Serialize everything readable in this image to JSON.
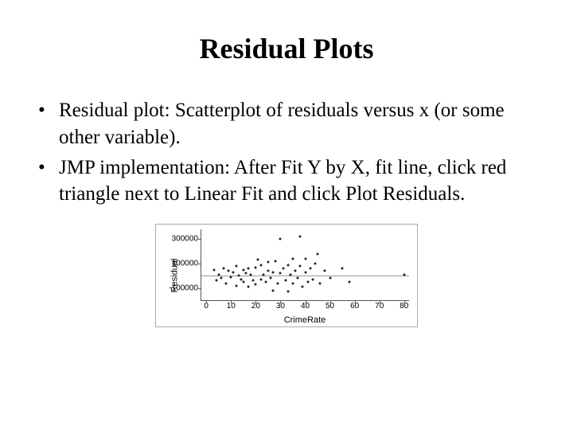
{
  "title": "Residual Plots",
  "bullets": [
    "Residual plot: Scatterplot of residuals versus x (or some other variable).",
    "JMP implementation: After Fit Y by X, fit line, click red triangle next to Linear Fit and click Plot Residuals."
  ],
  "chart_data": {
    "type": "scatter",
    "xlabel": "CrimeRate",
    "ylabel": "Residual",
    "xlim": [
      -2,
      82
    ],
    "ylim": [
      -200000,
      380000
    ],
    "xticks": [
      0,
      10,
      20,
      30,
      40,
      50,
      60,
      70,
      80
    ],
    "yticks": [
      -100000,
      100000,
      300000
    ],
    "points": [
      {
        "x": 3,
        "y": 50000
      },
      {
        "x": 4,
        "y": -40000
      },
      {
        "x": 5,
        "y": 10000
      },
      {
        "x": 6,
        "y": -20000
      },
      {
        "x": 7,
        "y": 60000
      },
      {
        "x": 8,
        "y": -60000
      },
      {
        "x": 9,
        "y": 40000
      },
      {
        "x": 10,
        "y": -10000
      },
      {
        "x": 11,
        "y": 30000
      },
      {
        "x": 12,
        "y": -80000
      },
      {
        "x": 12,
        "y": 80000
      },
      {
        "x": 13,
        "y": 0
      },
      {
        "x": 14,
        "y": -30000
      },
      {
        "x": 15,
        "y": 50000
      },
      {
        "x": 15,
        "y": -50000
      },
      {
        "x": 16,
        "y": 20000
      },
      {
        "x": 17,
        "y": 60000
      },
      {
        "x": 17,
        "y": -90000
      },
      {
        "x": 18,
        "y": 10000
      },
      {
        "x": 19,
        "y": -40000
      },
      {
        "x": 20,
        "y": 70000
      },
      {
        "x": 20,
        "y": -70000
      },
      {
        "x": 21,
        "y": 130000
      },
      {
        "x": 22,
        "y": -30000
      },
      {
        "x": 22,
        "y": 90000
      },
      {
        "x": 23,
        "y": 10000
      },
      {
        "x": 24,
        "y": -50000
      },
      {
        "x": 25,
        "y": 40000
      },
      {
        "x": 25,
        "y": 110000
      },
      {
        "x": 26,
        "y": -20000
      },
      {
        "x": 27,
        "y": 30000
      },
      {
        "x": 27,
        "y": -120000
      },
      {
        "x": 28,
        "y": 120000
      },
      {
        "x": 29,
        "y": -60000
      },
      {
        "x": 30,
        "y": 20000
      },
      {
        "x": 30,
        "y": 300000
      },
      {
        "x": 31,
        "y": 60000
      },
      {
        "x": 32,
        "y": -40000
      },
      {
        "x": 33,
        "y": 90000
      },
      {
        "x": 33,
        "y": -130000
      },
      {
        "x": 34,
        "y": 10000
      },
      {
        "x": 35,
        "y": -60000
      },
      {
        "x": 35,
        "y": 140000
      },
      {
        "x": 36,
        "y": 40000
      },
      {
        "x": 37,
        "y": -20000
      },
      {
        "x": 38,
        "y": 80000
      },
      {
        "x": 38,
        "y": 320000
      },
      {
        "x": 39,
        "y": -90000
      },
      {
        "x": 40,
        "y": 30000
      },
      {
        "x": 40,
        "y": 140000
      },
      {
        "x": 41,
        "y": -50000
      },
      {
        "x": 42,
        "y": 60000
      },
      {
        "x": 43,
        "y": -30000
      },
      {
        "x": 44,
        "y": 100000
      },
      {
        "x": 45,
        "y": 180000
      },
      {
        "x": 46,
        "y": -60000
      },
      {
        "x": 48,
        "y": 40000
      },
      {
        "x": 50,
        "y": -20000
      },
      {
        "x": 55,
        "y": 60000
      },
      {
        "x": 58,
        "y": -50000
      },
      {
        "x": 80,
        "y": 10000
      }
    ]
  }
}
